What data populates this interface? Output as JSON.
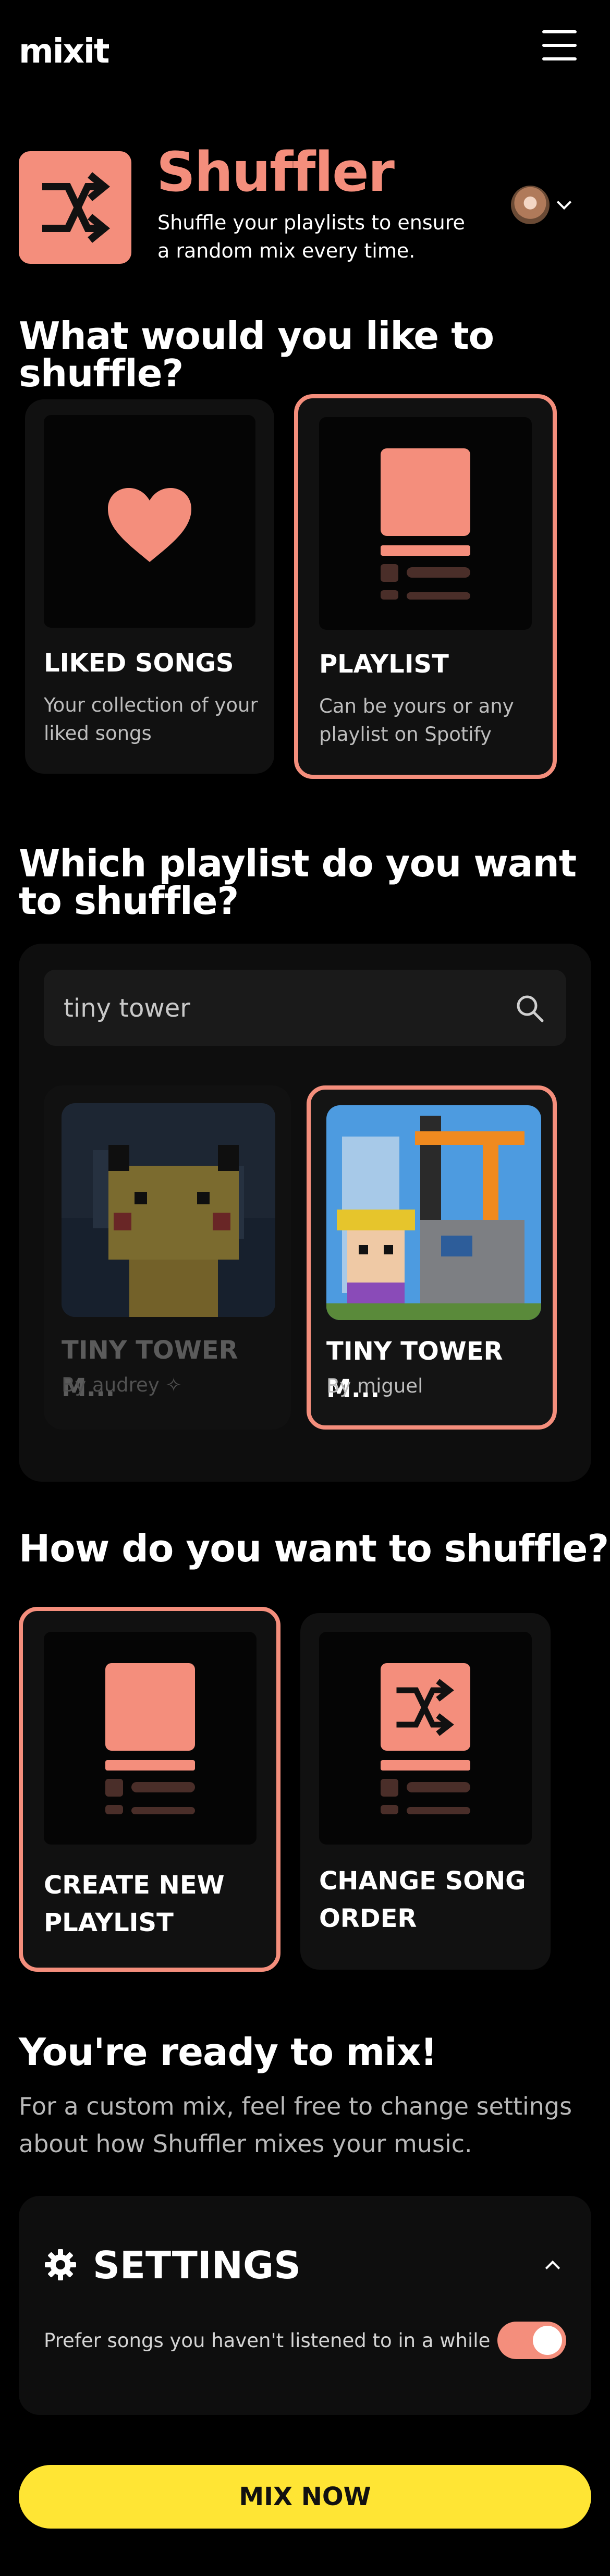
{
  "header": {
    "logo": "mixit"
  },
  "hero": {
    "title": "Shuffler",
    "subtitle": "Shuffle your playlists to ensure a random mix every time."
  },
  "source": {
    "heading": "What would you like to shuffle?",
    "options": [
      {
        "title": "LIKED SONGS",
        "description": "Your collection of your liked songs",
        "selected": false
      },
      {
        "title": "PLAYLIST",
        "description": "Can be yours or any playlist on Spotify",
        "selected": true
      }
    ]
  },
  "playlist_picker": {
    "heading": "Which playlist do you want to shuffle?",
    "search_value": "tiny tower",
    "results": [
      {
        "title": "TINY TOWER M...",
        "owner": "By audrey ✧",
        "selected": false
      },
      {
        "title": "TINY TOWER M...",
        "owner": "By miguel",
        "selected": true
      }
    ]
  },
  "method": {
    "heading": "How do you want to shuffle?",
    "options": [
      {
        "title": "CREATE NEW PLAYLIST",
        "selected": true
      },
      {
        "title": "CHANGE SONG ORDER",
        "selected": false
      }
    ]
  },
  "ready": {
    "heading": "You're ready to mix!",
    "text": "For a custom mix, feel free to change settings about how Shuffler mixes your music."
  },
  "settings": {
    "title": "SETTINGS",
    "prefer_label": "Prefer songs you haven't listened to in a while",
    "prefer_on": true
  },
  "cta": {
    "label": "MIX NOW"
  },
  "colors": {
    "accent": "#f48e7c",
    "cta": "#ffe534",
    "background": "#000000",
    "card": "#111111"
  },
  "icons": [
    "hamburger-menu-icon",
    "shuffle-icon",
    "heart-icon",
    "playlist-icon",
    "search-icon",
    "gear-icon",
    "chevron-up-icon",
    "chevron-down-icon"
  ]
}
